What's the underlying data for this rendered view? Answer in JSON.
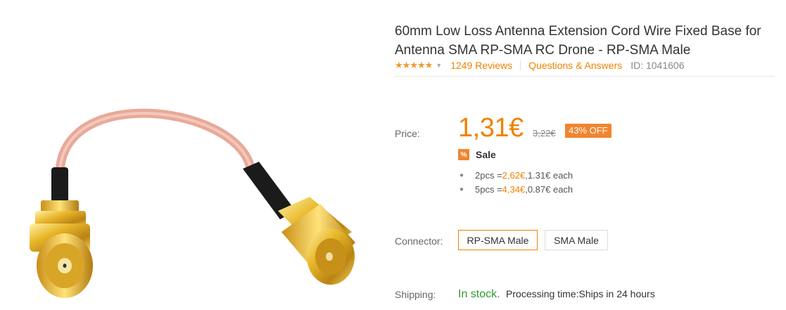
{
  "product": {
    "title": "60mm Low Loss Antenna Extension Cord Wire Fixed Base for Antenna SMA RP-SMA RC Drone - RP-SMA Male",
    "rating_stars": 5,
    "reviews": "1249 Reviews",
    "qa": "Questions & Answers",
    "id_label": "ID: 1041606"
  },
  "price": {
    "label": "Price:",
    "current": "1,31€",
    "original": "3,22€",
    "discount": "43% OFF",
    "sale_icon": "%",
    "sale_label": "Sale",
    "tiers": [
      {
        "qty": "2pcs = ",
        "total": "2,62€",
        "each": ",1.31€ each"
      },
      {
        "qty": "5pcs = ",
        "total": "4,34€",
        "each": ",0.87€ each"
      }
    ]
  },
  "connector": {
    "label": "Connector:",
    "options": [
      "RP-SMA Male",
      "SMA Male"
    ],
    "selected": "RP-SMA Male"
  },
  "shipping": {
    "label": "Shipping:",
    "status": "In stock.",
    "processing": "Processing time:Ships in 24 hours"
  },
  "colors": {
    "accent": "#f08200",
    "badge": "#f1852f",
    "stock": "#2d9a2d"
  },
  "icons": [
    "star-icon",
    "caret-down-icon",
    "sale-percent-icon"
  ]
}
